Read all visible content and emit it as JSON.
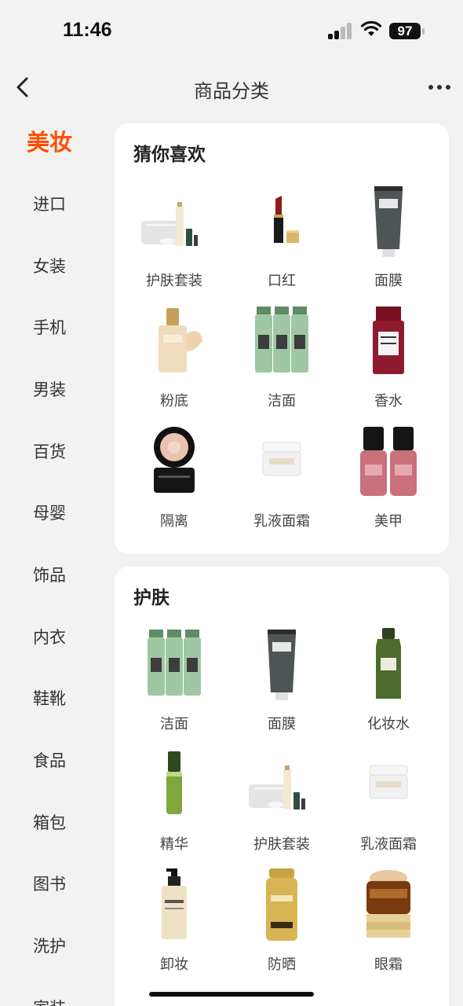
{
  "status": {
    "time": "11:46",
    "battery": "97"
  },
  "nav": {
    "title": "商品分类"
  },
  "sidebar": {
    "items": [
      {
        "label": "美妆"
      },
      {
        "label": "进口"
      },
      {
        "label": "女装"
      },
      {
        "label": "手机"
      },
      {
        "label": "男装"
      },
      {
        "label": "百货"
      },
      {
        "label": "母婴"
      },
      {
        "label": "饰品"
      },
      {
        "label": "内衣"
      },
      {
        "label": "鞋靴"
      },
      {
        "label": "食品"
      },
      {
        "label": "箱包"
      },
      {
        "label": "图书"
      },
      {
        "label": "洗护"
      },
      {
        "label": "家装"
      }
    ]
  },
  "sections": [
    {
      "title": "猜你喜欢",
      "items": [
        {
          "label": "护肤套装",
          "icon": "skincare-set-icon"
        },
        {
          "label": "口红",
          "icon": "lipstick-icon"
        },
        {
          "label": "面膜",
          "icon": "face-mask-tube-icon"
        },
        {
          "label": "粉底",
          "icon": "foundation-bottle-icon"
        },
        {
          "label": "洁面",
          "icon": "cleanser-bottles-icon"
        },
        {
          "label": "香水",
          "icon": "perfume-bottle-icon"
        },
        {
          "label": "隔离",
          "icon": "primer-jar-icon"
        },
        {
          "label": "乳液面霜",
          "icon": "cream-jar-icon"
        },
        {
          "label": "美甲",
          "icon": "nail-polish-icon"
        }
      ]
    },
    {
      "title": "护肤",
      "items": [
        {
          "label": "洁面",
          "icon": "cleanser-bottles-icon"
        },
        {
          "label": "面膜",
          "icon": "face-mask-tube-icon"
        },
        {
          "label": "化妆水",
          "icon": "toner-bottle-icon"
        },
        {
          "label": "精华",
          "icon": "serum-bottle-icon"
        },
        {
          "label": "护肤套装",
          "icon": "skincare-set-icon"
        },
        {
          "label": "乳液面霜",
          "icon": "cream-jar-icon"
        },
        {
          "label": "卸妆",
          "icon": "makeup-remover-pump-icon"
        },
        {
          "label": "防晒",
          "icon": "sunscreen-bottle-icon"
        },
        {
          "label": "眼霜",
          "icon": "eye-cream-jar-icon"
        }
      ]
    }
  ]
}
